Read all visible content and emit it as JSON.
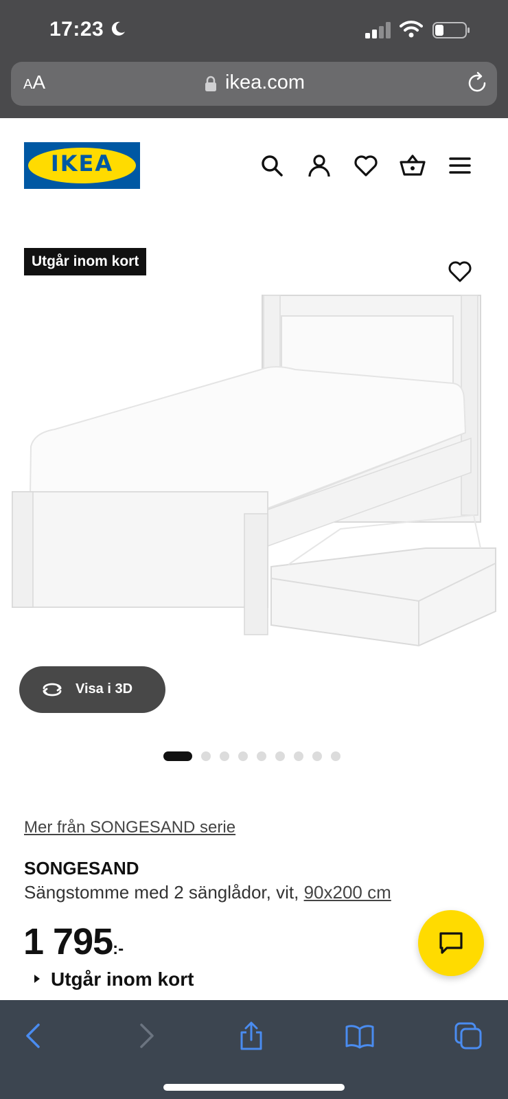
{
  "status_bar": {
    "time": "17:23",
    "moon_icon": "moon-icon",
    "signal_icon": "cellular-signal-icon",
    "wifi_icon": "wifi-icon",
    "battery_icon": "battery-icon"
  },
  "url_bar": {
    "text_size_label": "AA",
    "domain": "ikea.com",
    "lock_icon": "lock-icon",
    "reload_icon": "reload-icon"
  },
  "header": {
    "logo_text": "IKEA",
    "icons": [
      "search-icon",
      "account-icon",
      "wishlist-heart-icon",
      "shopping-basket-icon",
      "menu-icon"
    ]
  },
  "product_gallery": {
    "badge": "Utgår inom kort",
    "view_3d_label": "Visa i 3D",
    "slide_count": 9,
    "active_slide": 1
  },
  "product": {
    "series_link": "Mer från SONGESAND serie",
    "name": "SONGESAND",
    "description": "Sängstomme med 2 sänglådor, vit,",
    "size_link": "90x200 cm",
    "price": "1 795",
    "price_suffix": ":-",
    "availability": "Utgår inom kort"
  },
  "toolbar": {
    "icons": [
      "back-icon",
      "forward-icon",
      "share-icon",
      "bookmarks-icon",
      "tabs-icon"
    ]
  },
  "colors": {
    "ikea_blue": "#0058a3",
    "ikea_yellow": "#ffdb00",
    "browser_chrome": "#4a4a4c",
    "toolbar_bg": "#3c4550",
    "toolbar_icon": "#4a8cf0"
  }
}
